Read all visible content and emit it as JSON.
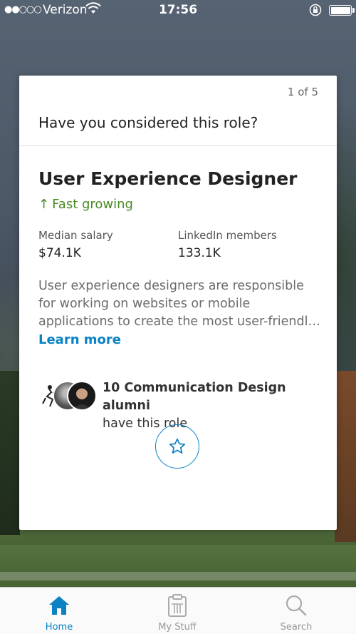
{
  "status_bar": {
    "signal": "●●○○○",
    "carrier": "Verizon",
    "time": "17:56"
  },
  "card": {
    "pager": "1 of 5",
    "prompt": "Have you considered this role?",
    "role_title": "User Experience Designer",
    "growth_label": "Fast growing",
    "growth_icon": "arrow-up-icon",
    "stats": {
      "salary_label": "Median salary",
      "salary_value": "$74.1K",
      "members_label": "LinkedIn members",
      "members_value": "133.1K"
    },
    "description": "User experience designers are responsible for working on websites or mobile applications to create the most user-friendly experience for t…",
    "learn_more": "Learn more",
    "alumni": {
      "line1": "10 Communication Design alumni",
      "line2": "have this role"
    },
    "save_icon": "star-icon"
  },
  "colors": {
    "accent": "#0a82c4",
    "growth": "#4a8a23"
  },
  "tab_bar": {
    "tabs": [
      {
        "label": "Home",
        "icon": "home-icon",
        "active": true
      },
      {
        "label": "My Stuff",
        "icon": "clipboard-icon",
        "active": false
      },
      {
        "label": "Search",
        "icon": "search-icon",
        "active": false
      }
    ]
  }
}
